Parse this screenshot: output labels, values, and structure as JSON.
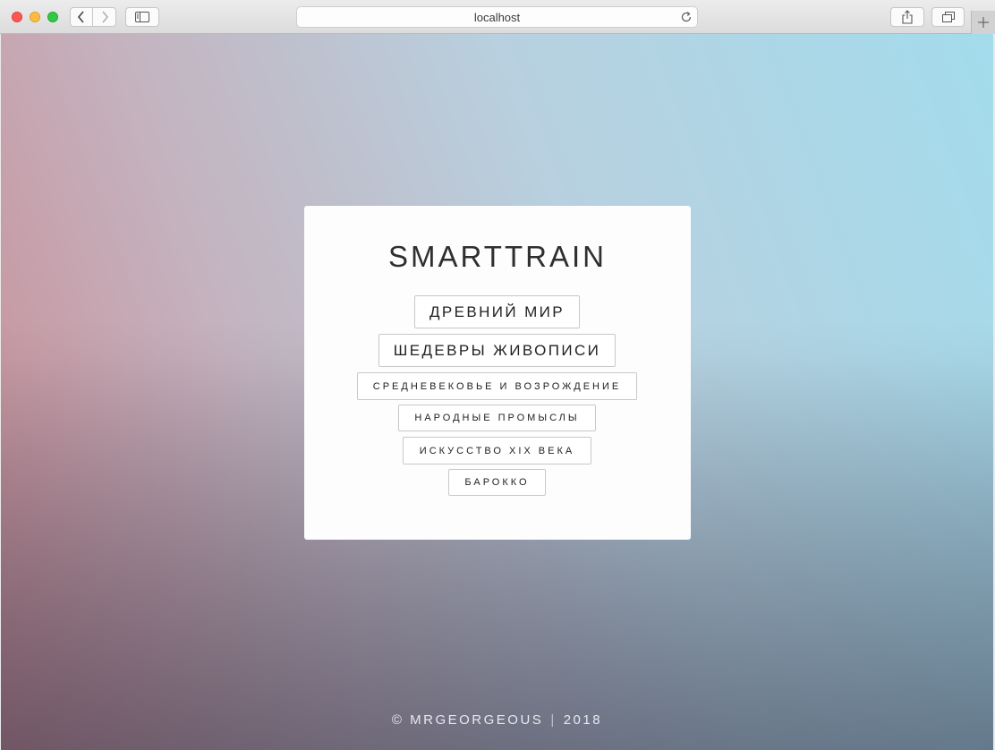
{
  "browser": {
    "address": "localhost",
    "icons": {
      "back": "chevron-left-icon",
      "forward": "chevron-right-icon",
      "sidebar": "sidebar-icon",
      "share": "share-icon",
      "tabs": "tabs-overview-icon",
      "reload": "reload-icon",
      "new_tab": "plus-icon"
    }
  },
  "page": {
    "title": "SMARTTRAIN",
    "menu": [
      {
        "label": "ДРЕВНИЙ МИР"
      },
      {
        "label": "ШЕДЕВРЫ ЖИВОПИСИ"
      },
      {
        "label": "СРЕДНЕВЕКОВЬЕ И ВОЗРОЖДЕНИЕ"
      },
      {
        "label": "НАРОДНЫЕ ПРОМЫСЛЫ"
      },
      {
        "label": "ИСКУССТВО XIX ВЕКА"
      },
      {
        "label": "БАРОККО"
      }
    ],
    "footer": {
      "author": "© MRGEORGEOUS",
      "separator": "|",
      "year": "2018"
    }
  },
  "colors": {
    "card_bg": "#fdfdfd",
    "title_text": "#2f2f2f",
    "button_border": "#c8c8c8",
    "footer_text": "#e9e9ee"
  }
}
